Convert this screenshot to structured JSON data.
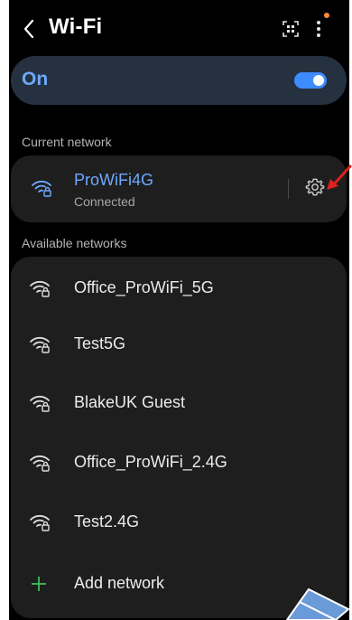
{
  "header": {
    "title": "Wi-Fi",
    "back_icon": "chevron-left-icon",
    "qr_icon": "qr-scan-icon",
    "more_icon": "more-vertical-icon",
    "notification_color": "#ff8a3a"
  },
  "wifi_toggle": {
    "label": "On",
    "state": true,
    "accent": "#3e8bff"
  },
  "current_network": {
    "section_label": "Current network",
    "name": "ProWiFi4G",
    "status": "Connected",
    "icon": "wifi-lock-icon",
    "settings_icon": "gear-icon"
  },
  "available_networks": {
    "section_label": "Available networks",
    "items": [
      {
        "name": "Office_ProWiFi_5G",
        "icon": "wifi-lock-icon"
      },
      {
        "name": "Test5G",
        "icon": "wifi-lock-icon"
      },
      {
        "name": "BlakeUK Guest",
        "icon": "wifi-lock-icon"
      },
      {
        "name": "Office_ProWiFi_2.4G",
        "icon": "wifi-lock-icon"
      },
      {
        "name": "Test2.4G",
        "icon": "wifi-lock-icon"
      }
    ],
    "add_label": "Add network",
    "add_icon": "plus-icon"
  },
  "annotations": {
    "red_arrow_color": "#e02020",
    "blue_arrow_color": "#6a9ad8"
  }
}
